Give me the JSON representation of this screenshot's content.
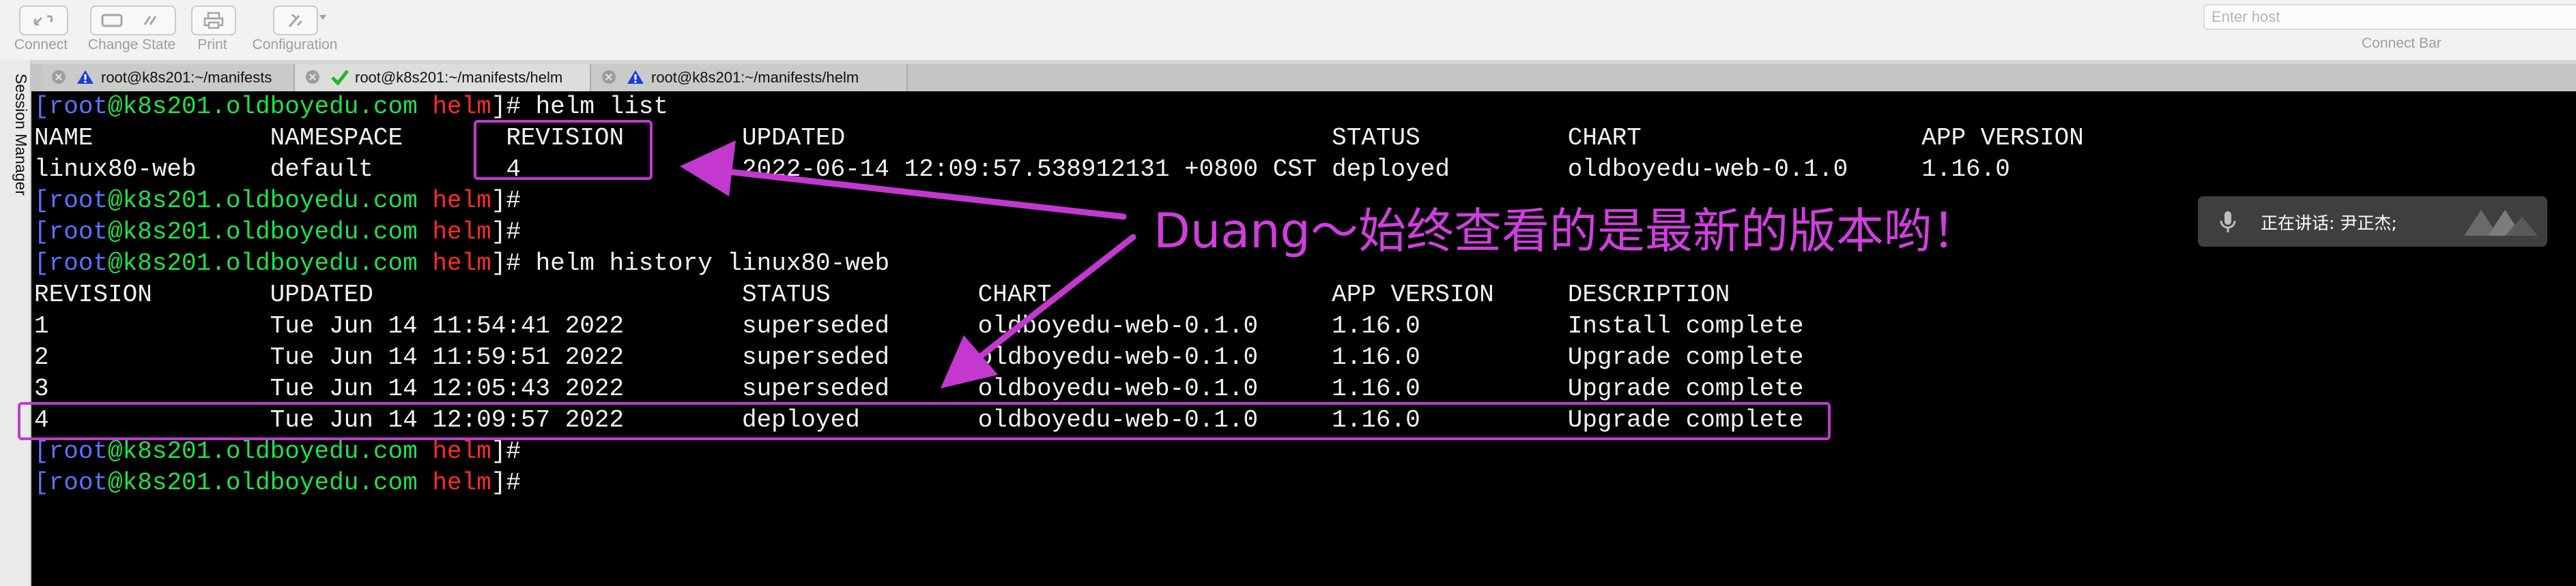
{
  "toolbar": {
    "connect": "Connect",
    "change_state": "Change State",
    "print": "Print",
    "configuration": "Configuration",
    "host_placeholder": "Enter host",
    "connect_bar": "Connect Bar"
  },
  "tabs": [
    {
      "title": "root@k8s201:~/manifests",
      "status": "warning"
    },
    {
      "title": "root@k8s201:~/manifests/helm",
      "status": "ok"
    },
    {
      "title": "root@k8s201:~/manifests/helm",
      "status": "warning"
    }
  ],
  "session_manager": "Session Manager",
  "prompt": {
    "lbracket": "[",
    "user": "root",
    "at": "@",
    "host": "k8s201.oldboyedu.com",
    "dir": " helm",
    "tail": "]#"
  },
  "terminal": {
    "cmd1": " helm list",
    "list_header": "NAME            NAMESPACE       REVISION        UPDATED                                 STATUS          CHART                   APP VERSION",
    "list_row": "linux80-web     default         4               2022-06-14 12:09:57.538912131 +0800 CST deployed        oldboyedu-web-0.1.0     1.16.0",
    "cmd2": " helm history linux80-web",
    "history_header": "REVISION        UPDATED                         STATUS          CHART                   APP VERSION     DESCRIPTION",
    "history_rows": [
      "1               Tue Jun 14 11:54:41 2022        superseded      oldboyedu-web-0.1.0     1.16.0          Install complete",
      "2               Tue Jun 14 11:59:51 2022        superseded      oldboyedu-web-0.1.0     1.16.0          Upgrade complete",
      "3               Tue Jun 14 12:05:43 2022        superseded      oldboyedu-web-0.1.0     1.16.0          Upgrade complete",
      "4               Tue Jun 14 12:09:57 2022        deployed        oldboyedu-web-0.1.0     1.16.0          Upgrade complete"
    ]
  },
  "annotation": "Duang～始终查看的是最新的版本哟！",
  "speaking": "正在讲话: 尹正杰;",
  "colors": {
    "annotation": "#cf3fdc",
    "prompt_bracket": "#5b72ff",
    "prompt_host": "#1fe24a",
    "prompt_dir": "#ff2a2a"
  }
}
